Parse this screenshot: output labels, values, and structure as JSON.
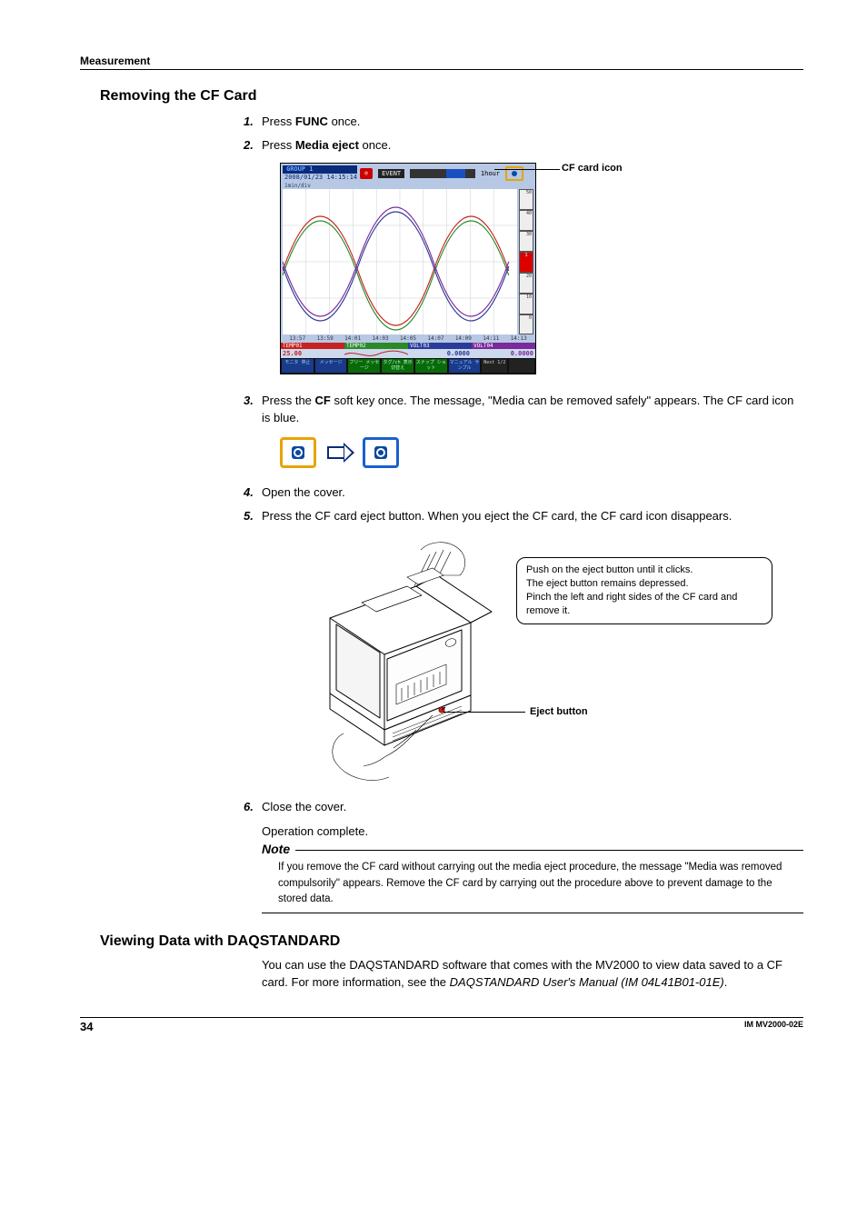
{
  "header": {
    "section": "Measurement"
  },
  "section1": {
    "title": "Removing the CF Card",
    "steps": {
      "1": {
        "pre": "Press ",
        "kw": "FUNC",
        "post": " once."
      },
      "2": {
        "pre": "Press ",
        "kw": "Media eject",
        "post": " once."
      },
      "3": {
        "pre": "Press the ",
        "kw": "CF",
        "post": " soft key once. The message, \"Media can be removed safely\" appears. The CF card icon is blue."
      },
      "4": {
        "text": "Open the cover."
      },
      "5": {
        "text": "Press the CF card eject button. When you eject the CF card, the CF card icon disappears."
      },
      "6": {
        "text": "Close the cover."
      }
    },
    "cf_icon_label": "CF card icon",
    "screenshot": {
      "group": "GROUP 1",
      "datetime": "2008/01/23 14:15:14",
      "event": "EVENT",
      "hour": "1hour",
      "scale_top": "1min/div",
      "channels": [
        {
          "hdr": "TEMP01",
          "val": "25.00"
        },
        {
          "hdr": "TEMP02",
          "val": ""
        },
        {
          "hdr": "VOLT03",
          "val": "0.0000"
        },
        {
          "hdr": "VOLT04",
          "val": "0.0000"
        }
      ],
      "softkeys": [
        "モニタ\n停止",
        "メッセージ",
        "フリー\nメッセージ",
        "タグ/ch\n表示切替え",
        "スナップ\nショット",
        "マニュアル\nサンプル",
        "Next 1/2"
      ],
      "rscale_mark": "1"
    },
    "callout": {
      "l1": "Push on the eject button until it clicks.",
      "l2": "The eject button remains depressed.",
      "l3": "Pinch the left and right sides of the CF card and remove it."
    },
    "eject_label": "Eject button",
    "op_complete": "Operation complete.",
    "note_head": "Note",
    "note_text": "If you remove the CF card without carrying out the media eject procedure, the message \"Media was removed compulsorily\" appears. Remove the CF card by carrying out the procedure above to prevent damage to the stored data."
  },
  "section2": {
    "title": "Viewing Data with DAQSTANDARD",
    "para_pre": "You can use the DAQSTANDARD software that comes with the MV2000 to view data saved to a CF card. For more information, see the ",
    "para_em": "DAQSTANDARD User's Manual (IM 04L41B01-01E)",
    "para_post": "."
  },
  "footer": {
    "page": "34",
    "doc": "IM MV2000-02E"
  }
}
